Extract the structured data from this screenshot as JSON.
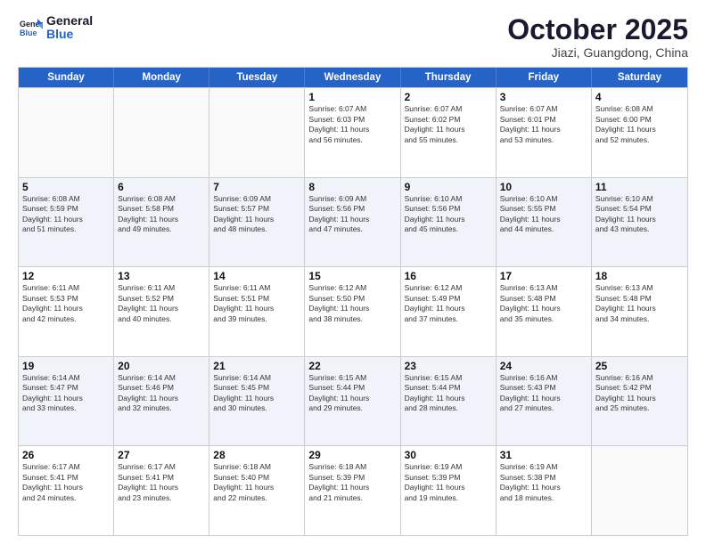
{
  "logo": {
    "line1": "General",
    "line2": "Blue"
  },
  "title": "October 2025",
  "subtitle": "Jiazi, Guangdong, China",
  "days": [
    "Sunday",
    "Monday",
    "Tuesday",
    "Wednesday",
    "Thursday",
    "Friday",
    "Saturday"
  ],
  "rows": [
    [
      {
        "day": "",
        "info": ""
      },
      {
        "day": "",
        "info": ""
      },
      {
        "day": "",
        "info": ""
      },
      {
        "day": "1",
        "info": "Sunrise: 6:07 AM\nSunset: 6:03 PM\nDaylight: 11 hours\nand 56 minutes."
      },
      {
        "day": "2",
        "info": "Sunrise: 6:07 AM\nSunset: 6:02 PM\nDaylight: 11 hours\nand 55 minutes."
      },
      {
        "day": "3",
        "info": "Sunrise: 6:07 AM\nSunset: 6:01 PM\nDaylight: 11 hours\nand 53 minutes."
      },
      {
        "day": "4",
        "info": "Sunrise: 6:08 AM\nSunset: 6:00 PM\nDaylight: 11 hours\nand 52 minutes."
      }
    ],
    [
      {
        "day": "5",
        "info": "Sunrise: 6:08 AM\nSunset: 5:59 PM\nDaylight: 11 hours\nand 51 minutes."
      },
      {
        "day": "6",
        "info": "Sunrise: 6:08 AM\nSunset: 5:58 PM\nDaylight: 11 hours\nand 49 minutes."
      },
      {
        "day": "7",
        "info": "Sunrise: 6:09 AM\nSunset: 5:57 PM\nDaylight: 11 hours\nand 48 minutes."
      },
      {
        "day": "8",
        "info": "Sunrise: 6:09 AM\nSunset: 5:56 PM\nDaylight: 11 hours\nand 47 minutes."
      },
      {
        "day": "9",
        "info": "Sunrise: 6:10 AM\nSunset: 5:56 PM\nDaylight: 11 hours\nand 45 minutes."
      },
      {
        "day": "10",
        "info": "Sunrise: 6:10 AM\nSunset: 5:55 PM\nDaylight: 11 hours\nand 44 minutes."
      },
      {
        "day": "11",
        "info": "Sunrise: 6:10 AM\nSunset: 5:54 PM\nDaylight: 11 hours\nand 43 minutes."
      }
    ],
    [
      {
        "day": "12",
        "info": "Sunrise: 6:11 AM\nSunset: 5:53 PM\nDaylight: 11 hours\nand 42 minutes."
      },
      {
        "day": "13",
        "info": "Sunrise: 6:11 AM\nSunset: 5:52 PM\nDaylight: 11 hours\nand 40 minutes."
      },
      {
        "day": "14",
        "info": "Sunrise: 6:11 AM\nSunset: 5:51 PM\nDaylight: 11 hours\nand 39 minutes."
      },
      {
        "day": "15",
        "info": "Sunrise: 6:12 AM\nSunset: 5:50 PM\nDaylight: 11 hours\nand 38 minutes."
      },
      {
        "day": "16",
        "info": "Sunrise: 6:12 AM\nSunset: 5:49 PM\nDaylight: 11 hours\nand 37 minutes."
      },
      {
        "day": "17",
        "info": "Sunrise: 6:13 AM\nSunset: 5:48 PM\nDaylight: 11 hours\nand 35 minutes."
      },
      {
        "day": "18",
        "info": "Sunrise: 6:13 AM\nSunset: 5:48 PM\nDaylight: 11 hours\nand 34 minutes."
      }
    ],
    [
      {
        "day": "19",
        "info": "Sunrise: 6:14 AM\nSunset: 5:47 PM\nDaylight: 11 hours\nand 33 minutes."
      },
      {
        "day": "20",
        "info": "Sunrise: 6:14 AM\nSunset: 5:46 PM\nDaylight: 11 hours\nand 32 minutes."
      },
      {
        "day": "21",
        "info": "Sunrise: 6:14 AM\nSunset: 5:45 PM\nDaylight: 11 hours\nand 30 minutes."
      },
      {
        "day": "22",
        "info": "Sunrise: 6:15 AM\nSunset: 5:44 PM\nDaylight: 11 hours\nand 29 minutes."
      },
      {
        "day": "23",
        "info": "Sunrise: 6:15 AM\nSunset: 5:44 PM\nDaylight: 11 hours\nand 28 minutes."
      },
      {
        "day": "24",
        "info": "Sunrise: 6:16 AM\nSunset: 5:43 PM\nDaylight: 11 hours\nand 27 minutes."
      },
      {
        "day": "25",
        "info": "Sunrise: 6:16 AM\nSunset: 5:42 PM\nDaylight: 11 hours\nand 25 minutes."
      }
    ],
    [
      {
        "day": "26",
        "info": "Sunrise: 6:17 AM\nSunset: 5:41 PM\nDaylight: 11 hours\nand 24 minutes."
      },
      {
        "day": "27",
        "info": "Sunrise: 6:17 AM\nSunset: 5:41 PM\nDaylight: 11 hours\nand 23 minutes."
      },
      {
        "day": "28",
        "info": "Sunrise: 6:18 AM\nSunset: 5:40 PM\nDaylight: 11 hours\nand 22 minutes."
      },
      {
        "day": "29",
        "info": "Sunrise: 6:18 AM\nSunset: 5:39 PM\nDaylight: 11 hours\nand 21 minutes."
      },
      {
        "day": "30",
        "info": "Sunrise: 6:19 AM\nSunset: 5:39 PM\nDaylight: 11 hours\nand 19 minutes."
      },
      {
        "day": "31",
        "info": "Sunrise: 6:19 AM\nSunset: 5:38 PM\nDaylight: 11 hours\nand 18 minutes."
      },
      {
        "day": "",
        "info": ""
      }
    ]
  ]
}
